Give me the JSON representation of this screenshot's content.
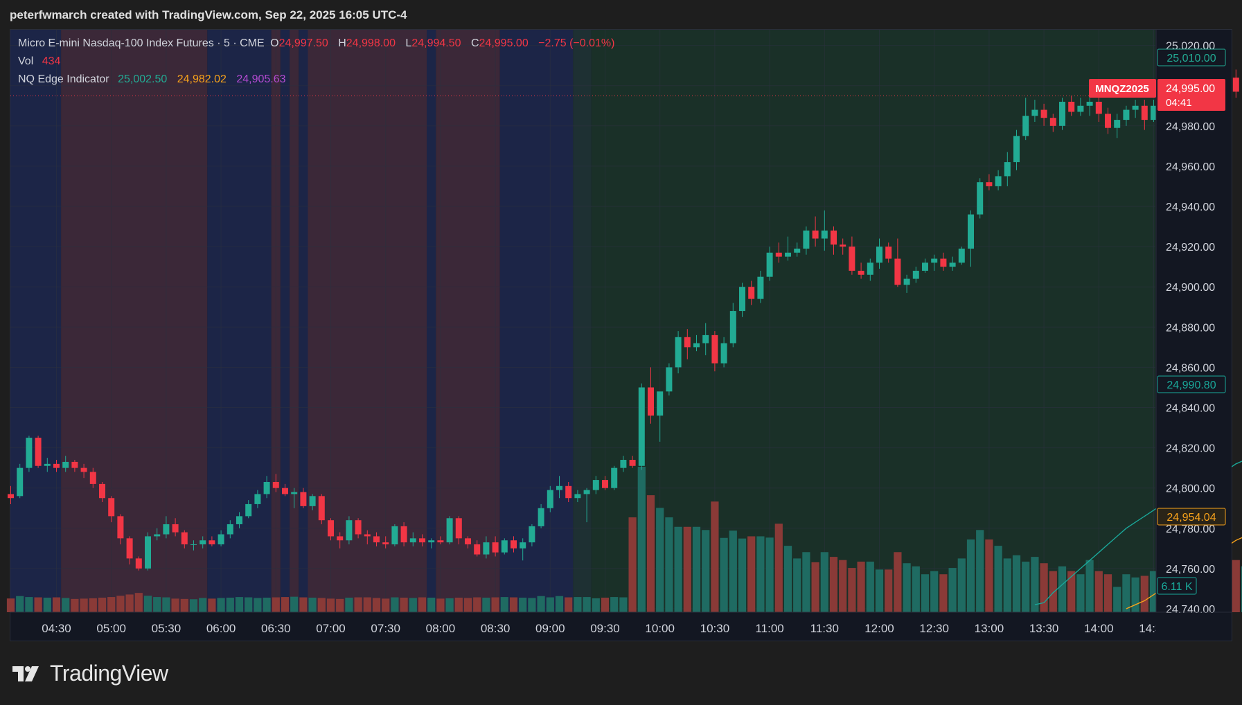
{
  "header": {
    "watermark": "peterfwmarch created with TradingView.com, Sep 22, 2025 16:05 UTC-4"
  },
  "legend": {
    "symbol": "Micro E-mini Nasdaq-100 Index Futures · 5 · CME",
    "o_label": "O",
    "o": "24,997.50",
    "h_label": "H",
    "h": "24,998.00",
    "l_label": "L",
    "l": "24,994.50",
    "c_label": "C",
    "c": "24,995.00",
    "change": "−2.75 (−0.01%)",
    "vol_label": "Vol",
    "vol": "434",
    "ind_label": "NQ Edge Indicator",
    "ind1": "25,002.50",
    "ind2": "24,982.02",
    "ind3": "24,905.63"
  },
  "price_tags": {
    "top": "25,010.00",
    "symbol": "MNQZ2025",
    "last": "24,995.00",
    "countdown": "04:41",
    "ind_teal": "24,990.80",
    "ind_orange": "24,954.04",
    "volume": "6.11 K"
  },
  "brand": {
    "name": "TradingView"
  },
  "colors": {
    "up": "#22ab94",
    "down": "#f23645",
    "vol_up": "#1f6b62",
    "vol_down": "#8a3a37",
    "teal_line": "#1aa89a",
    "orange_line": "#f7a21b",
    "purple": "#b44bd1"
  },
  "chart_data": {
    "type": "candlestick",
    "bar_interval_minutes": 5,
    "y_ticks": [
      24740,
      24760,
      24780,
      24800,
      24820,
      24840,
      24860,
      24880,
      24900,
      24920,
      24940,
      24960,
      24980,
      25000,
      25020
    ],
    "y_tick_labels": [
      "24,740.00",
      "24,760.00",
      "24,780.00",
      "24,800.00",
      "24,820.00",
      "24,840.00",
      "24,860.00",
      "24,880.00",
      "24,900.00",
      "24,920.00",
      "24,940.00",
      "24,960.00",
      "24,980.00",
      "25,000.00",
      "25,020.00"
    ],
    "x_ticks": [
      "04:30",
      "05:00",
      "05:30",
      "06:00",
      "06:30",
      "07:00",
      "07:30",
      "08:00",
      "08:30",
      "09:00",
      "09:30",
      "10:00",
      "10:30",
      "11:00",
      "11:30",
      "12:00",
      "12:30",
      "13:00",
      "13:30",
      "14:00",
      "14:30"
    ],
    "x_ticks_time": [
      "04:30",
      "05:00",
      "05:30",
      "06:00",
      "06:30",
      "07:00",
      "07:30",
      "08:00",
      "08:30",
      "09:00",
      "09:30",
      "10:00",
      "10:30",
      "11:00",
      "11:30",
      "12:00",
      "12:30",
      "13:00",
      "13:30",
      "14:00",
      "14:30"
    ],
    "first_bar_time": "04:05",
    "last_price": 24995,
    "session_shading": [
      {
        "from": "04:00",
        "to": "04:35",
        "color": "#1c2547"
      },
      {
        "from": "04:35",
        "to": "05:55",
        "color": "#3b2838"
      },
      {
        "from": "05:55",
        "to": "06:30",
        "color": "#1c2547"
      },
      {
        "from": "06:30",
        "to": "06:35",
        "color": "#3b2838"
      },
      {
        "from": "06:35",
        "to": "06:40",
        "color": "#1c2547"
      },
      {
        "from": "06:40",
        "to": "06:45",
        "color": "#3b2838"
      },
      {
        "from": "06:45",
        "to": "06:50",
        "color": "#1c2547"
      },
      {
        "from": "06:50",
        "to": "07:55",
        "color": "#3b2838"
      },
      {
        "from": "07:55",
        "to": "08:00",
        "color": "#1c2547"
      },
      {
        "from": "08:00",
        "to": "08:35",
        "color": "#3b2838"
      },
      {
        "from": "08:35",
        "to": "09:15",
        "color": "#1c2547"
      },
      {
        "from": "09:15",
        "to": "09:25",
        "color": "#1e3033"
      },
      {
        "from": "09:25",
        "to": "14:40",
        "color": "#1a3028"
      }
    ],
    "ohlc": [
      [
        24797,
        24801,
        24792,
        24795
      ],
      [
        24796,
        24812,
        24795,
        24810
      ],
      [
        24810,
        24826,
        24808,
        24825
      ],
      [
        24825,
        24826,
        24810,
        24811
      ],
      [
        24811,
        24815,
        24808,
        24812
      ],
      [
        24812,
        24814,
        24808,
        24810
      ],
      [
        24810,
        24816,
        24808,
        24813
      ],
      [
        24813,
        24814,
        24808,
        24810
      ],
      [
        24810,
        24812,
        24805,
        24808
      ],
      [
        24808,
        24810,
        24800,
        24802
      ],
      [
        24802,
        24803,
        24793,
        24795
      ],
      [
        24795,
        24796,
        24783,
        24786
      ],
      [
        24786,
        24787,
        24772,
        24775
      ],
      [
        24775,
        24776,
        24762,
        24765
      ],
      [
        24765,
        24766,
        24759,
        24760
      ],
      [
        24760,
        24778,
        24759,
        24776
      ],
      [
        24776,
        24780,
        24774,
        24777
      ],
      [
        24777,
        24786,
        24775,
        24782
      ],
      [
        24782,
        24785,
        24776,
        24778
      ],
      [
        24778,
        24779,
        24770,
        24772
      ],
      [
        24772,
        24774,
        24769,
        24772
      ],
      [
        24772,
        24776,
        24770,
        24774
      ],
      [
        24774,
        24776,
        24771,
        24772
      ],
      [
        24772,
        24779,
        24771,
        24777
      ],
      [
        24777,
        24784,
        24775,
        24782
      ],
      [
        24782,
        24788,
        24780,
        24786
      ],
      [
        24786,
        24794,
        24785,
        24792
      ],
      [
        24792,
        24799,
        24790,
        24797
      ],
      [
        24797,
        24806,
        24795,
        24803
      ],
      [
        24803,
        24807,
        24798,
        24800
      ],
      [
        24800,
        24802,
        24796,
        24797
      ],
      [
        24797,
        24800,
        24790,
        24798
      ],
      [
        24798,
        24800,
        24790,
        24791
      ],
      [
        24791,
        24797,
        24789,
        24796
      ],
      [
        24796,
        24797,
        24782,
        24784
      ],
      [
        24784,
        24785,
        24774,
        24776
      ],
      [
        24776,
        24778,
        24770,
        24774
      ],
      [
        24774,
        24786,
        24772,
        24784
      ],
      [
        24784,
        24785,
        24775,
        24777
      ],
      [
        24777,
        24779,
        24772,
        24776
      ],
      [
        24776,
        24778,
        24771,
        24773
      ],
      [
        24773,
        24776,
        24770,
        24772
      ],
      [
        24772,
        24782,
        24771,
        24781
      ],
      [
        24781,
        24783,
        24771,
        24773
      ],
      [
        24773,
        24778,
        24771,
        24775
      ],
      [
        24775,
        24777,
        24771,
        24773
      ],
      [
        24773,
        24775,
        24770,
        24774
      ],
      [
        24774,
        24776,
        24772,
        24773
      ],
      [
        24773,
        24786,
        24772,
        24785
      ],
      [
        24785,
        24786,
        24772,
        24775
      ],
      [
        24775,
        24776,
        24770,
        24772
      ],
      [
        24772,
        24774,
        24766,
        24767
      ],
      [
        24767,
        24776,
        24765,
        24773
      ],
      [
        24773,
        24776,
        24766,
        24768
      ],
      [
        24768,
        24775,
        24767,
        24774
      ],
      [
        24774,
        24776,
        24768,
        24770
      ],
      [
        24770,
        24775,
        24764,
        24773
      ],
      [
        24773,
        24782,
        24771,
        24781
      ],
      [
        24781,
        24792,
        24780,
        24790
      ],
      [
        24790,
        24801,
        24788,
        24799
      ],
      [
        24799,
        24806,
        24795,
        24801
      ],
      [
        24801,
        24803,
        24793,
        24795
      ],
      [
        24795,
        24799,
        24793,
        24797
      ],
      [
        24797,
        24800,
        24783,
        24799
      ],
      [
        24799,
        24806,
        24797,
        24804
      ],
      [
        24804,
        24806,
        24799,
        24800
      ],
      [
        24800,
        24811,
        24799,
        24810
      ],
      [
        24810,
        24816,
        24808,
        24814
      ],
      [
        24814,
        24816,
        24810,
        24811
      ],
      [
        24811,
        24852,
        24809,
        24850
      ],
      [
        24850,
        24860,
        24832,
        24836
      ],
      [
        24836,
        24842,
        24823,
        24848
      ],
      [
        24848,
        24862,
        24846,
        24860
      ],
      [
        24860,
        24878,
        24857,
        24875
      ],
      [
        24875,
        24879,
        24864,
        24870
      ],
      [
        24870,
        24876,
        24868,
        24872
      ],
      [
        24872,
        24882,
        24866,
        24876
      ],
      [
        24876,
        24878,
        24858,
        24862
      ],
      [
        24862,
        24875,
        24860,
        24872
      ],
      [
        24872,
        24892,
        24870,
        24888
      ],
      [
        24888,
        24902,
        24885,
        24900
      ],
      [
        24900,
        24903,
        24891,
        24894
      ],
      [
        24894,
        24908,
        24892,
        24905
      ],
      [
        24905,
        24920,
        24903,
        24917
      ],
      [
        24917,
        24922,
        24912,
        24915
      ],
      [
        24915,
        24925,
        24913,
        24917
      ],
      [
        24917,
        24922,
        24915,
        24919
      ],
      [
        24919,
        24930,
        24916,
        24928
      ],
      [
        24928,
        24935,
        24920,
        24924
      ],
      [
        24924,
        24938,
        24918,
        24928
      ],
      [
        24928,
        24930,
        24916,
        24921
      ],
      [
        24921,
        24924,
        24916,
        24920
      ],
      [
        24920,
        24925,
        24906,
        24908
      ],
      [
        24908,
        24912,
        24904,
        24906
      ],
      [
        24906,
        24914,
        24903,
        24912
      ],
      [
        24912,
        24924,
        24909,
        24920
      ],
      [
        24920,
        24922,
        24912,
        24914
      ],
      [
        24914,
        24924,
        24900,
        24901
      ],
      [
        24901,
        24906,
        24897,
        24904
      ],
      [
        24904,
        24910,
        24902,
        24908
      ],
      [
        24908,
        24914,
        24907,
        24912
      ],
      [
        24912,
        24916,
        24908,
        24914
      ],
      [
        24914,
        24917,
        24908,
        24910
      ],
      [
        24910,
        24915,
        24908,
        24912
      ],
      [
        24912,
        24920,
        24911,
        24919
      ],
      [
        24919,
        24938,
        24910,
        24936
      ],
      [
        24936,
        24954,
        24934,
        24952
      ],
      [
        24952,
        24956,
        24948,
        24950
      ],
      [
        24950,
        24958,
        24948,
        24955
      ],
      [
        24955,
        24967,
        24950,
        24962
      ],
      [
        24962,
        24978,
        24958,
        24975
      ],
      [
        24975,
        24994,
        24973,
        24985
      ],
      [
        24985,
        24993,
        24982,
        24988
      ],
      [
        24988,
        24991,
        24980,
        24984
      ],
      [
        24984,
        24986,
        24977,
        24980
      ],
      [
        24980,
        24994,
        24978,
        24992
      ],
      [
        24992,
        24995,
        24985,
        24987
      ],
      [
        24987,
        24994,
        24985,
        24990
      ],
      [
        24990,
        24995,
        24985,
        24992
      ],
      [
        24992,
        24995,
        24982,
        24986
      ],
      [
        24986,
        24989,
        24976,
        24979
      ],
      [
        24979,
        24986,
        24974,
        24983
      ],
      [
        24983,
        24990,
        24980,
        24988
      ],
      [
        24988,
        24993,
        24984,
        24990
      ],
      [
        24990,
        24993,
        24978,
        24983
      ],
      [
        24983,
        24993,
        24982,
        24990
      ],
      [
        24990,
        24998,
        24988,
        24996
      ],
      [
        24996,
        25000,
        24994,
        24995
      ],
      [
        24995,
        24997,
        24991,
        24993
      ],
      [
        24993,
        24996,
        24984,
        24990
      ],
      [
        24990,
        24993,
        24983,
        24987
      ],
      [
        24987,
        24992,
        24985,
        24990
      ],
      [
        24990,
        24997,
        24988,
        24995
      ],
      [
        24995,
        25006,
        24993,
        25004
      ],
      [
        25004,
        25008,
        24994,
        24997
      ],
      [
        24997,
        25011,
        24995,
        25002
      ],
      [
        24997,
        24998,
        24994.5,
        24995
      ]
    ],
    "volume": [
      434,
      510,
      480,
      470,
      460,
      470,
      450,
      420,
      430,
      440,
      460,
      480,
      520,
      560,
      610,
      520,
      480,
      470,
      430,
      420,
      410,
      450,
      430,
      450,
      460,
      480,
      470,
      450,
      460,
      470,
      480,
      490,
      470,
      460,
      450,
      430,
      420,
      460,
      470,
      470,
      450,
      430,
      470,
      460,
      450,
      470,
      460,
      430,
      440,
      460,
      450,
      470,
      460,
      470,
      480,
      470,
      460,
      450,
      510,
      470,
      510,
      470,
      480,
      480,
      440,
      460,
      480,
      470,
      3000,
      4600,
      3700,
      3300,
      3000,
      2700,
      2700,
      2700,
      2600,
      3500,
      2350,
      2580,
      2330,
      2400,
      2400,
      2360,
      2800,
      2100,
      1700,
      1900,
      1580,
      1900,
      1750,
      1650,
      1400,
      1600,
      1600,
      1350,
      1350,
      1900,
      1550,
      1450,
      1200,
      1300,
      1200,
      1400,
      1700,
      2300,
      2600,
      2300,
      2100,
      1700,
      1800,
      1600,
      1750,
      1550,
      1300,
      1450,
      1300,
      1200,
      1650,
      1300,
      1200,
      800,
      1200,
      1100,
      1150,
      1300,
      1150,
      1050,
      1200,
      800,
      1050,
      1450,
      1100,
      1300,
      1650,
      1450,
      1050,
      1300,
      1250,
      1150,
      1250,
      1150,
      1450,
      1350,
      1650,
      1100,
      1150,
      1150,
      1300,
      1050,
      1350,
      1250,
      1600,
      1100,
      1050,
      1250,
      1500,
      1650,
      1200,
      1250
    ],
    "indicator_teal": [
      [
        24742,
        24743,
        24748,
        24752,
        24756,
        24760,
        24764,
        24768,
        24772,
        24776,
        24780,
        24783,
        24786,
        24789,
        24792,
        24794,
        24797,
        24800,
        24802,
        24805,
        24807,
        24809,
        24812,
        24814,
        24817,
        24818,
        24820,
        24822,
        24824,
        24827,
        24830,
        24832,
        24836,
        24838,
        24840,
        24843,
        24846,
        24848,
        24851,
        24853,
        24855,
        24857,
        24860
      ]
    ],
    "indicator_teal_start_bar": 112,
    "indicator_orange": [
      24740,
      24742,
      24744,
      24747,
      24750,
      24753,
      24756,
      24759,
      24762,
      24765,
      24768,
      24771,
      24774,
      24776,
      24779,
      24782,
      24785,
      24788,
      24791,
      24794,
      24797,
      24800,
      24803,
      24806,
      24809,
      24812,
      24815,
      24818,
      24821,
      24824,
      24827,
      24830,
      24833
    ],
    "indicator_orange_start_bar": 122
  }
}
